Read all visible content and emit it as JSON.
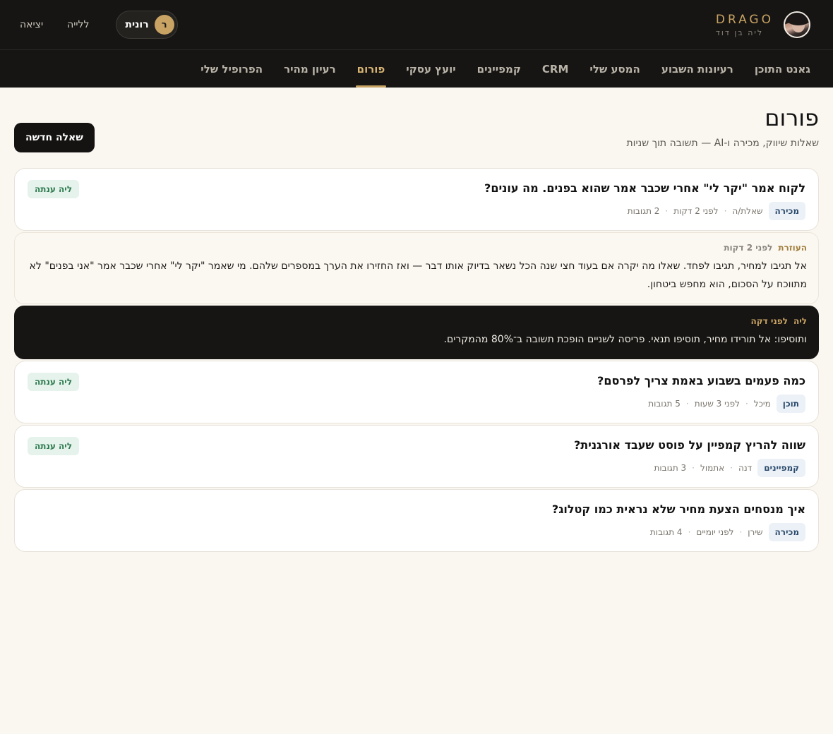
{
  "brand": {
    "name": "DRAGO",
    "sub": "ליה בן דוד"
  },
  "top": {
    "user_name": "רונית",
    "user_initial": "ר",
    "lia_label": "ללייה",
    "exit_label": "יציאה"
  },
  "nav": {
    "items": [
      "גאנט התוכן",
      "רעיונות השבוע",
      "המסע שלי",
      "CRM",
      "קמפיינים",
      "יועץ עסקי",
      "פורום",
      "רעיון מהיר",
      "הפרופיל שלי"
    ],
    "active": "פורום"
  },
  "page": {
    "title": "פורום",
    "subtitle": "שאלות שיווק, מכירה ו-AI — תשובה תוך שניות",
    "new_button": "שאלה חדשה"
  },
  "threads": [
    {
      "title": "לקוח אמר \"יקר לי\" אחרי שכבר אמר שהוא בפנים. מה עונים?",
      "tag": "מכירה",
      "author": "שאלת/ה",
      "time": "לפני 2 דקות",
      "replies": "2 תגובות",
      "answered": "ליה ענתה",
      "expanded": [
        {
          "style": "light",
          "author": "העוזרת",
          "time": "לפני 2 דקות",
          "body": "אל תגיבו למחיר, תגיבו לפחד. שאלו מה יקרה אם בעוד חצי שנה הכל נשאר בדיוק אותו דבר — ואז החזירו את הערך במספרים שלהם. מי שאמר \"יקר לי\" אחרי שכבר אמר \"אני בפנים\" לא מתווכח על הסכום, הוא מחפש ביטחון."
        },
        {
          "style": "dark",
          "author": "ליה",
          "time": "לפני דקה",
          "body": "ותוסיפו: אל תורידו מחיר, תוסיפו תנאי. פריסה לשניים הופכת תשובה ב־80% מהמקרים."
        }
      ]
    },
    {
      "title": "כמה פעמים בשבוע באמת צריך לפרסם?",
      "tag": "תוכן",
      "author": "מיכל",
      "time": "לפני 3 שעות",
      "replies": "5 תגובות",
      "answered": "ליה ענתה"
    },
    {
      "title": "שווה להריץ קמפיין על פוסט שעבד אורגנית?",
      "tag": "קמפיינים",
      "author": "דנה",
      "time": "אתמול",
      "replies": "3 תגובות",
      "answered": "ליה ענתה"
    },
    {
      "title": "איך מנסחים הצעת מחיר שלא נראית כמו קטלוג?",
      "tag": "מכירה",
      "author": "שירן",
      "time": "לפני יומיים",
      "replies": "4 תגובות",
      "answered": ""
    }
  ]
}
